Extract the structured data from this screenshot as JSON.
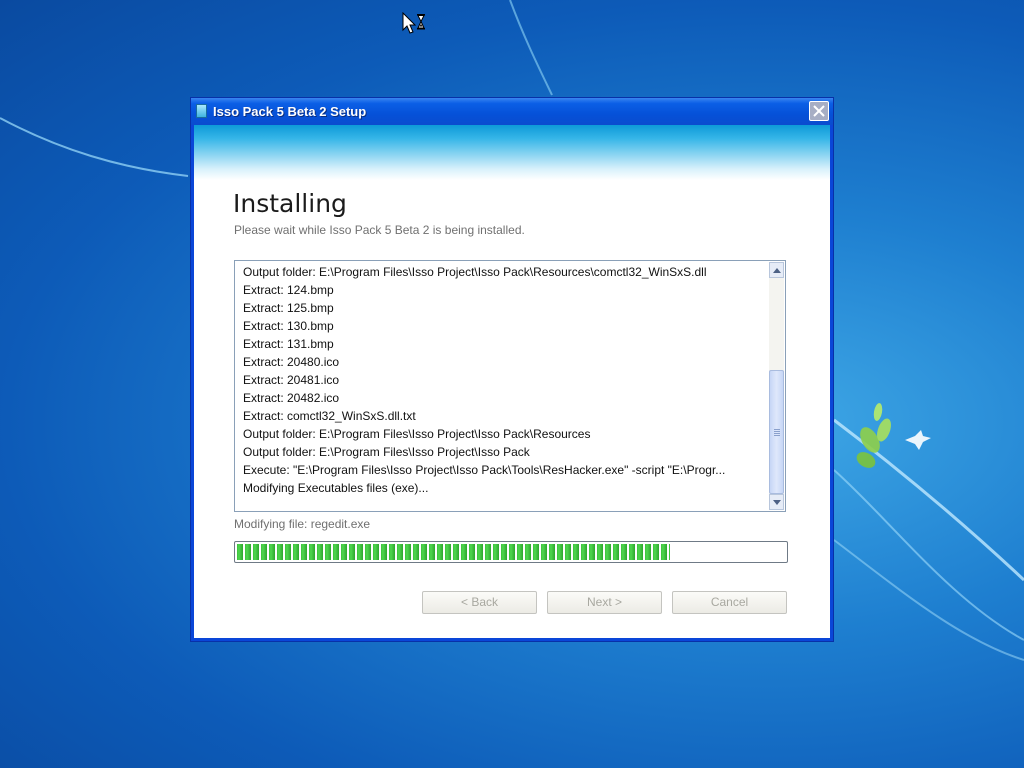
{
  "window": {
    "title": "Isso Pack 5 Beta 2 Setup"
  },
  "page": {
    "heading": "Installing",
    "subheading": "Please wait while Isso Pack 5 Beta 2 is being installed."
  },
  "log": [
    "Output folder: E:\\Program Files\\Isso Project\\Isso Pack\\Resources\\comctl32_WinSxS.dll",
    "Extract: 124.bmp",
    "Extract: 125.bmp",
    "Extract: 130.bmp",
    "Extract: 131.bmp",
    "Extract: 20480.ico",
    "Extract: 20481.ico",
    "Extract: 20482.ico",
    "Extract: comctl32_WinSxS.dll.txt",
    "Output folder: E:\\Program Files\\Isso Project\\Isso Pack\\Resources",
    "Output folder: E:\\Program Files\\Isso Project\\Isso Pack",
    "Execute: \"E:\\Program Files\\Isso Project\\Isso Pack\\Tools\\ResHacker.exe\" -script \"E:\\Progr...",
    "Modifying Executables files (exe)..."
  ],
  "status": {
    "text": "Modifying file: regedit.exe",
    "progress_fraction": 0.79
  },
  "buttons": {
    "back": "< Back",
    "next": "Next >",
    "cancel": "Cancel"
  },
  "colors": {
    "title_bar": "#0651d8",
    "progress_green": "#3bc23b",
    "desktop": "#1e7fd0"
  },
  "icons": {
    "cursor": "busy-arrow-cursor",
    "close": "close-x-icon",
    "scroll_up": "arrow-up-icon",
    "scroll_down": "arrow-down-icon"
  }
}
